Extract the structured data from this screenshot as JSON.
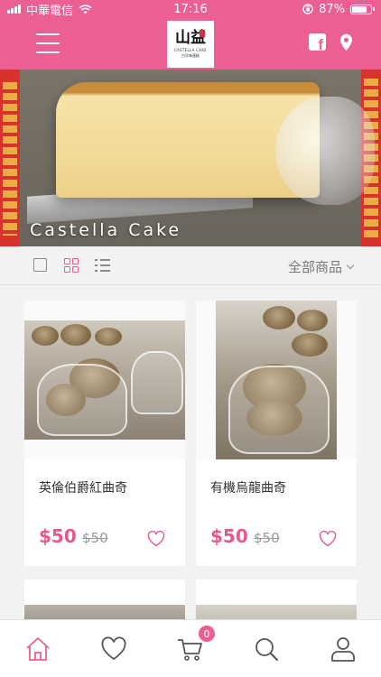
{
  "status_bar": {
    "carrier": "中華電信",
    "time": "17:16",
    "battery": "87%"
  },
  "header": {
    "logo": {
      "main": "山益",
      "sub": "CASTELLA CAKE",
      "sub2": "古早味蛋糕"
    },
    "icons": [
      "menu-icon",
      "facebook-icon",
      "location-pin-icon"
    ]
  },
  "banner": {
    "caption": "Castella Cake"
  },
  "toolbar": {
    "view_modes": [
      "single-view-icon",
      "grid-view-icon",
      "list-view-icon"
    ],
    "active_view": "grid",
    "filter_label": "全部商品"
  },
  "products": [
    {
      "name": "英倫伯爵紅曲奇",
      "price": "$50",
      "original_price": "$50"
    },
    {
      "name": "有機烏龍曲奇",
      "price": "$50",
      "original_price": "$50"
    }
  ],
  "bottom_nav": {
    "items": [
      "home-icon",
      "favorites-icon",
      "cart-icon",
      "search-icon",
      "account-icon"
    ],
    "cart_count": "0",
    "active": "home"
  },
  "colors": {
    "brand_pink": "#ec5f92",
    "price_pink": "#e8588e"
  }
}
